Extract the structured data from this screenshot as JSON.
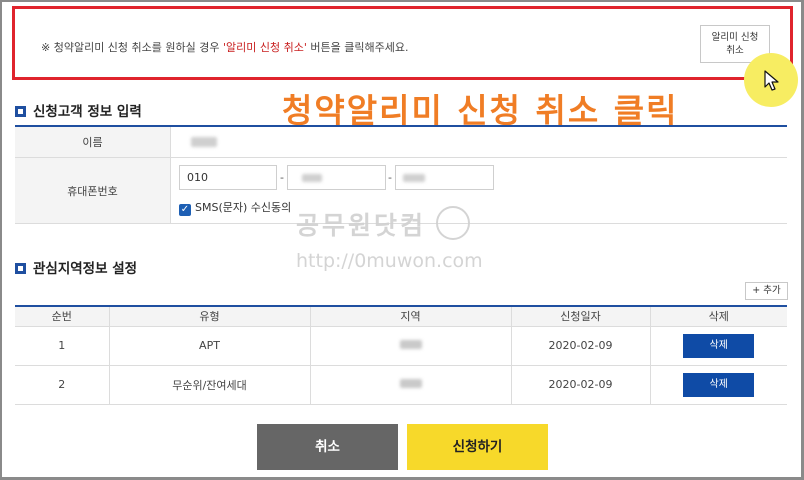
{
  "notice": {
    "prefix": "※ 청약알리미 신청 취소를 원하실 경우 ",
    "highlight": "'알리미 신청 취소'",
    "suffix": " 버튼을 클릭해주세요.",
    "button_line1": "알리미 신청",
    "button_line2": "취소"
  },
  "overlay_caption": "청약알리미 신청 취소 클릭",
  "customer_section": {
    "title": "신청고객 정보 입력",
    "name_label": "이름",
    "phone_label": "휴대폰번호",
    "phone_first": "010",
    "phone_dash": "-",
    "sms_label": "SMS(문자) 수신동의",
    "sms_checked": true
  },
  "region_section": {
    "title": "관심지역정보 설정",
    "add_button": "+ 추가",
    "columns": [
      "순번",
      "유형",
      "지역",
      "신청일자",
      "삭제"
    ],
    "rows": [
      {
        "no": "1",
        "type": "APT",
        "date": "2020-02-09",
        "delete": "삭제"
      },
      {
        "no": "2",
        "type": "무순위/잔여세대",
        "date": "2020-02-09",
        "delete": "삭제"
      }
    ]
  },
  "watermark": {
    "title": "공무원닷컴",
    "url": "http://0muwon.com"
  },
  "actions": {
    "cancel": "취소",
    "apply": "신청하기"
  },
  "colors": {
    "accent_blue": "#1f4fa0",
    "delete_button": "#0f4ba6",
    "notice_border": "#e0242d",
    "overlay_text": "#f07d25",
    "apply_button": "#f7d92a",
    "cancel_button": "#666666"
  }
}
